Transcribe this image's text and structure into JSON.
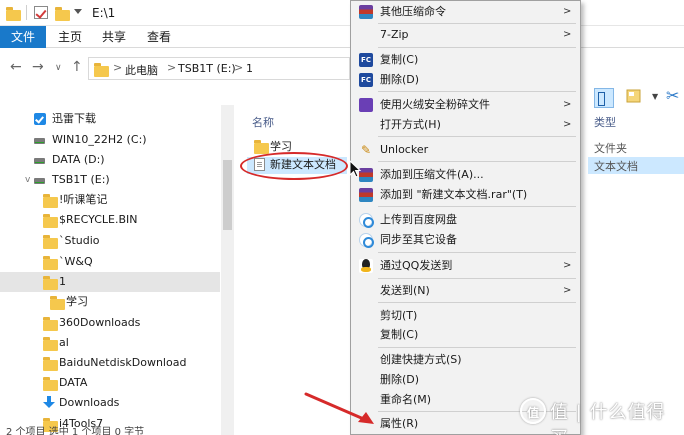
{
  "window": {
    "title": "E:\\1"
  },
  "ribbon": {
    "tabs": [
      "文件",
      "主页",
      "共享",
      "查看"
    ]
  },
  "address": {
    "crumbs": [
      "此电脑",
      "TSB1T (E:)",
      "1"
    ],
    "separator": ">"
  },
  "nav_pane": {
    "items": [
      {
        "label": "迅雷下载",
        "icon": "xunlei-check-icon"
      },
      {
        "label": "WIN10_22H2 (C:)",
        "icon": "drive-icon"
      },
      {
        "label": "DATA (D:)",
        "icon": "drive-icon"
      },
      {
        "label": "TSB1T (E:)",
        "icon": "drive-icon"
      },
      {
        "label": "!听课笔记",
        "icon": "folder-icon"
      },
      {
        "label": "$RECYCLE.BIN",
        "icon": "folder-icon"
      },
      {
        "label": "`Studio",
        "icon": "folder-icon"
      },
      {
        "label": "`W&Q",
        "icon": "folder-icon"
      },
      {
        "label": "1",
        "icon": "folder-icon"
      },
      {
        "label": "学习",
        "icon": "folder-icon"
      },
      {
        "label": "360Downloads",
        "icon": "folder-icon"
      },
      {
        "label": "al",
        "icon": "folder-icon"
      },
      {
        "label": "BaiduNetdiskDownload",
        "icon": "folder-icon"
      },
      {
        "label": "DATA",
        "icon": "folder-icon"
      },
      {
        "label": "Downloads",
        "icon": "download-icon"
      },
      {
        "label": "i4Tools7",
        "icon": "folder-icon"
      }
    ]
  },
  "file_pane": {
    "col_name": "名称",
    "col_type": "类型",
    "files": [
      {
        "name": "学习",
        "type": "文件夹",
        "icon": "folder-icon"
      },
      {
        "name": "新建文本文档",
        "type": "文本文档",
        "icon": "text-document-icon",
        "selected": true
      }
    ]
  },
  "context_menu": {
    "items": [
      {
        "label": "其他压缩命令",
        "icon": "winrar-icon",
        "submenu": true
      },
      {
        "label": "7-Zip",
        "icon": "",
        "submenu": true
      },
      {
        "label": "复制(C)",
        "icon": "fc-icon",
        "submenu": false
      },
      {
        "label": "删除(D)",
        "icon": "fc-icon",
        "submenu": false
      },
      {
        "label": "使用火绒安全粉碎文件",
        "icon": "huorong-icon",
        "submenu": true
      },
      {
        "label": "打开方式(H)",
        "icon": "",
        "submenu": true
      },
      {
        "label": "Unlocker",
        "icon": "unlocker-icon",
        "submenu": false
      },
      {
        "label": "添加到压缩文件(A)...",
        "icon": "winrar-icon",
        "submenu": false
      },
      {
        "label": "添加到 \"新建文本文档.rar\"(T)",
        "icon": "winrar-icon",
        "submenu": false
      },
      {
        "label": "上传到百度网盘",
        "icon": "baidu-cloud-icon",
        "submenu": false
      },
      {
        "label": "同步至其它设备",
        "icon": "baidu-cloud-icon",
        "submenu": false
      },
      {
        "label": "通过QQ发送到",
        "icon": "qq-icon",
        "submenu": true
      },
      {
        "label": "发送到(N)",
        "icon": "",
        "submenu": true
      },
      {
        "label": "剪切(T)",
        "icon": "",
        "submenu": false
      },
      {
        "label": "复制(C)",
        "icon": "",
        "submenu": false
      },
      {
        "label": "创建快捷方式(S)",
        "icon": "",
        "submenu": false
      },
      {
        "label": "删除(D)",
        "icon": "",
        "submenu": false
      },
      {
        "label": "重命名(M)",
        "icon": "",
        "submenu": false
      },
      {
        "label": "属性(R)",
        "icon": "",
        "submenu": false
      }
    ]
  },
  "status": {
    "text": "2 个项目    选中 1 个项目  0 字节"
  },
  "watermark": {
    "text": "值 | 什么值得买",
    "badge": "值"
  },
  "colors": {
    "accent": "#1979ca",
    "selection": "#cce8ff",
    "annotation_red": "#d62a2a"
  }
}
